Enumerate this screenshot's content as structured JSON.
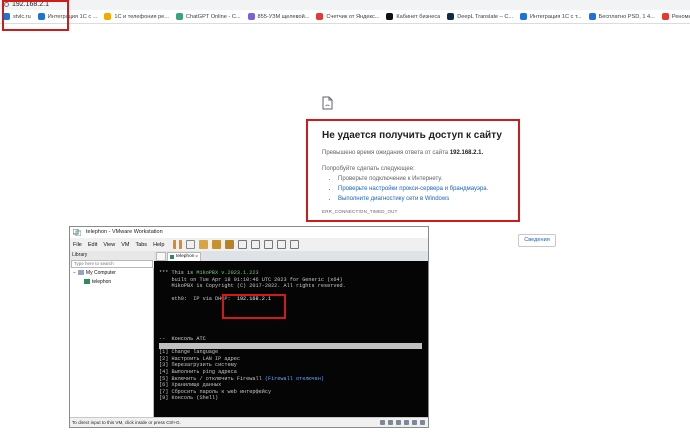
{
  "address_bar": {
    "url": "192.168.2.1"
  },
  "bookmarks": [
    {
      "label": "stvlc.ru",
      "color": "#1e73d9"
    },
    {
      "label": "Интеграция 1С с ...",
      "color": "#1e73d9"
    },
    {
      "label": "1С и телефония ре...",
      "color": "#f2a900"
    },
    {
      "label": "ChatGPT Online - С...",
      "color": "#3aa37a"
    },
    {
      "label": "855-УЗМ щелевой...",
      "color": "#7b62d9"
    },
    {
      "label": "Счетчик от Яндекс...",
      "color": "#e53935"
    },
    {
      "label": "Кабинет бизнеса",
      "color": "#111111"
    },
    {
      "label": "DeepL Translate – С...",
      "color": "#0f2b46"
    },
    {
      "label": "Интеграция 1С с т...",
      "color": "#1e73d9"
    },
    {
      "label": "Бесплатно PSD, 1 4...",
      "color": "#1e73d9"
    },
    {
      "label": "Реноме",
      "color": "#e53935"
    },
    {
      "label": "Поиск пользовате...",
      "color": "#f4b400"
    },
    {
      "label": "Dealer Private | Sky...",
      "color": "#d62b2b"
    }
  ],
  "error_page": {
    "icon": "broken-page-icon",
    "title": "Не удается получить доступ к сайту",
    "subtitle_prefix": "Превышено время ожидания ответа от сайта",
    "subtitle_host": "192.168.2.1.",
    "try_label": "Попробуйте сделать следующее:",
    "suggestions": [
      {
        "text": "Проверьте подключение к Интернету.",
        "link": false
      },
      {
        "text": "Проверьте настройки прокси-сервера и брандмауэра.",
        "link": true
      },
      {
        "text": "Выполните диагностику сети в Windows",
        "link": true
      }
    ],
    "error_code": "ERR_CONNECTION_TIMED_OUT",
    "details_button": "Сведения"
  },
  "vmware": {
    "title": "telephon - VMware Workstation",
    "menu": [
      "File",
      "Edit",
      "View",
      "VM",
      "Tabs",
      "Help"
    ],
    "library_label": "Library",
    "search_placeholder": "Type here to search",
    "tree": {
      "root": "My Computer",
      "child": "telephon"
    },
    "tab_label": "telephon",
    "status_text": "To direct input to this VM, click inside or press Ctrl+G."
  },
  "console": {
    "banner_prefix": "*** This is ",
    "banner_version": "MikoPBX v.2023.1.223",
    "line_built": "    built on Tue Apr 18 01:10:46 UTC 2023 for Generic (x64)",
    "line_copyright": "    MikoPBX is Copyright (C) 2017-2022. All rights reserved.",
    "eth_label": "    eth0:  IP via DHCP:  ",
    "eth_ip": "192.168.2.1",
    "menu_title": "--  Консоль АТС  ",
    "menu_items": [
      "[1] Change language",
      "[2] Настроить LAN IP адрес",
      "[3] Перезагрузить систему",
      "[4] Выполнить ping адреса",
      "[6] Хранилище данных",
      "[7] Сбросить пароль к web интерфейсу",
      "[9] Консоль (Shell)"
    ],
    "firewall_item_prefix": "[5] Включить / отключить Firewall ",
    "firewall_item_status": "(Firewall отключен)"
  }
}
